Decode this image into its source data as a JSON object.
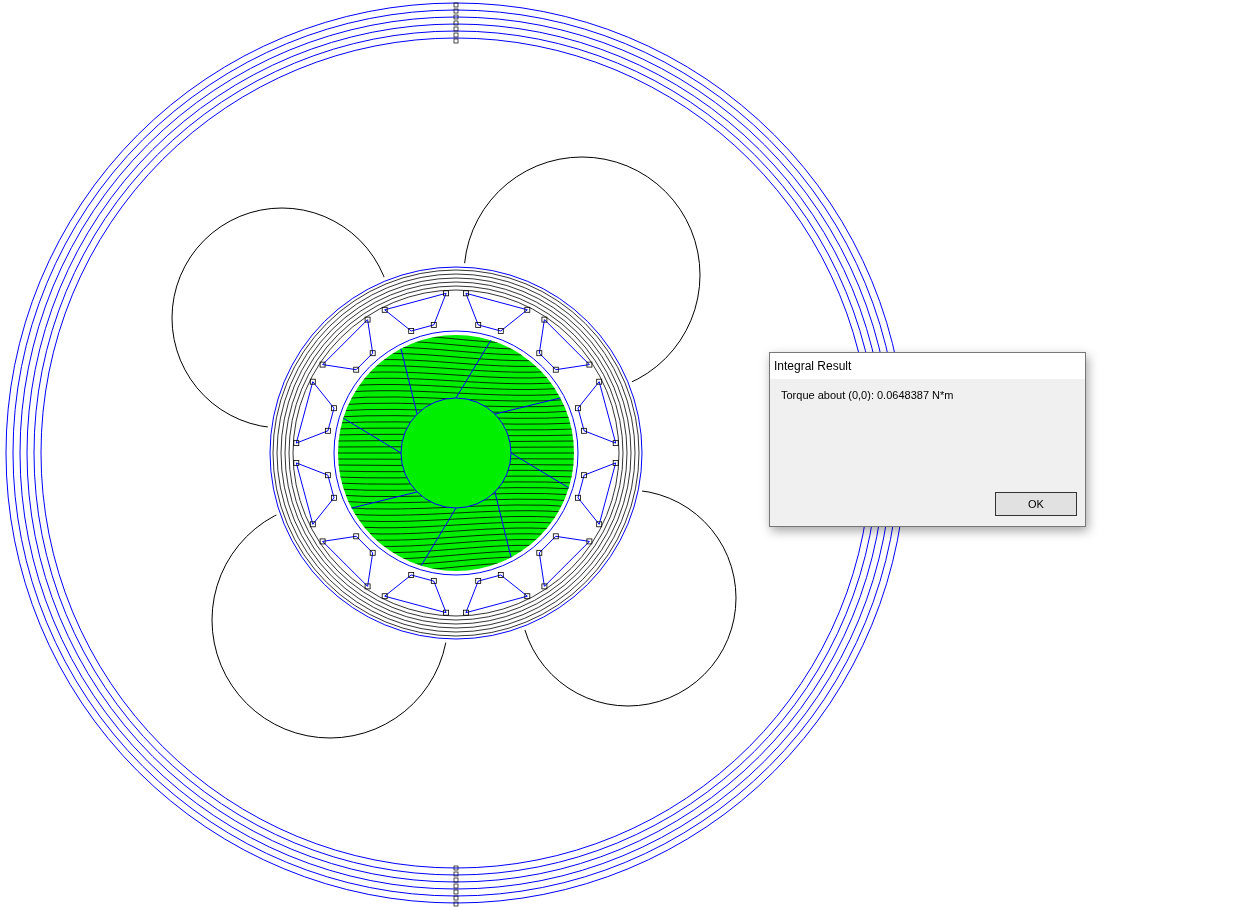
{
  "dialog": {
    "title": "Integral Result",
    "message": "Torque about (0,0): 0.0648387 N*m",
    "buttons": [
      "OK"
    ]
  }
}
